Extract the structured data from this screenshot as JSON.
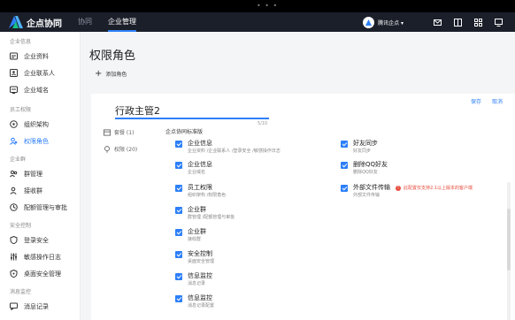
{
  "app": {
    "logo_text": "企点协同",
    "dots": "• • •",
    "tabs": [
      {
        "label": "协同",
        "active": false
      },
      {
        "label": "企业管理",
        "active": true
      }
    ],
    "org_name": "腾讯企点 ▾",
    "top_icons": [
      "mail-icon",
      "book-icon",
      "grid-icon",
      "monitor-icon"
    ]
  },
  "sidebar": {
    "groups": [
      {
        "title": "企业信息",
        "items": [
          {
            "label": "企业资料",
            "icon": "id-card-icon"
          },
          {
            "label": "企业联系人",
            "icon": "contact-icon"
          },
          {
            "label": "企业域名",
            "icon": "domain-icon"
          }
        ]
      },
      {
        "title": "员工权限",
        "items": [
          {
            "label": "组织架构",
            "icon": "org-icon"
          },
          {
            "label": "权限角色",
            "icon": "role-icon",
            "active": true
          }
        ]
      },
      {
        "title": "企业群",
        "items": [
          {
            "label": "群管理",
            "icon": "group-icon"
          },
          {
            "label": "接收群",
            "icon": "receive-icon"
          },
          {
            "label": "配额管理与审批",
            "icon": "quota-icon"
          }
        ]
      },
      {
        "title": "安全控制",
        "items": [
          {
            "label": "登录安全",
            "icon": "shield-icon"
          },
          {
            "label": "敏感操作日志",
            "icon": "sliders-icon"
          },
          {
            "label": "桌面安全管理",
            "icon": "desktop-shield-icon"
          }
        ]
      },
      {
        "title": "消息监控",
        "items": [
          {
            "label": "消息记录",
            "icon": "message-icon"
          }
        ]
      }
    ]
  },
  "main": {
    "page_title": "权限角色",
    "add_button": "添加角色",
    "save": "保存",
    "cancel": "取消",
    "role_name": "行政主管2",
    "role_count": "5/10",
    "tabs": [
      {
        "label": "套餐 (1)",
        "icon": "package-icon"
      },
      {
        "label": "权限 (20)",
        "icon": "permission-icon"
      }
    ],
    "section_title": "企点协同标准版",
    "left_permissions": [
      {
        "title": "企业信息",
        "sub": "企业资料 /企业联系人 /登录安全 /敏感操作日志"
      },
      {
        "title": "企业信息",
        "sub": "企业域名"
      },
      {
        "title": "员工权限",
        "sub": "组织架构 /权限角色"
      },
      {
        "title": "企业群",
        "sub": "群管理 /配额管理与审批"
      },
      {
        "title": "企业群",
        "sub": "接收群"
      },
      {
        "title": "安全控制",
        "sub": "桌面安全管理"
      },
      {
        "title": "信息监控",
        "sub": "消息记录"
      },
      {
        "title": "信息监控",
        "sub": "消息记录配置"
      }
    ],
    "right_permissions": [
      {
        "title": "好友同步",
        "sub": "好友同步"
      },
      {
        "title": "删除QQ好友",
        "sub": "删除QQ好友"
      },
      {
        "title": "外部文件传输",
        "sub": "外部文件传输",
        "warning": "此配置仅支持2.1以上版本的客户端"
      }
    ]
  }
}
